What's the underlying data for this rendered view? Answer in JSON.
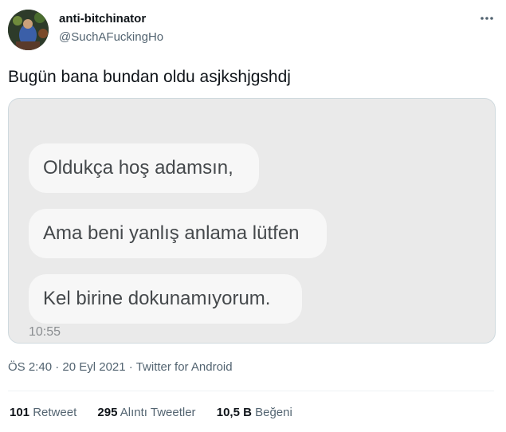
{
  "tweet": {
    "display_name": "anti-bitchinator",
    "handle": "@SuchAFuckingHo",
    "text": "Bugün bana bundan oldu asjkshjgshdj",
    "media": {
      "messages": [
        "Oldukça hoş adamsın,",
        "Ama beni yanlış anlama lütfen",
        "Kel birine dokunamıyorum."
      ],
      "time": "10:55"
    },
    "meta": {
      "time": "ÖS 2:40",
      "separator": "·",
      "date": "20 Eyl 2021",
      "source": "Twitter for Android"
    },
    "stats": {
      "retweets_count": "101",
      "retweets_label": "Retweet",
      "quotes_count": "295",
      "quotes_label": "Alıntı Tweetler",
      "likes_count": "10,5 B",
      "likes_label": "Beğeni"
    }
  },
  "colors": {
    "primary_text": "#0f1419",
    "secondary_text": "#536471",
    "media_background": "#eaeaea",
    "bubble_background": "#f7f7f7",
    "border": "#cfd9de"
  },
  "icons": {
    "more": "more-dots-icon",
    "avatar": "avatar"
  }
}
